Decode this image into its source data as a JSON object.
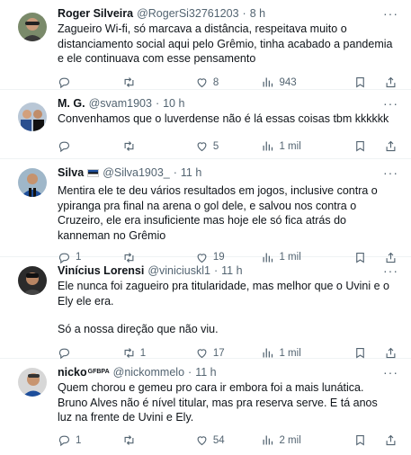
{
  "tweets": [
    {
      "name": "Roger Silveira",
      "handle": "@RogerSi32761203",
      "time": "8 h",
      "text": [
        "Zagueiro Wi-fi, só marcava a distância, respeitava muito o distanciamento social aqui pelo Grêmio, tinha acabado a pandemia e ele continuava com esse pensamento"
      ],
      "replies": "",
      "reposts": "",
      "likes": "8",
      "views": "943"
    },
    {
      "name": "M. G.",
      "handle": "@svam1903",
      "time": "10 h",
      "text": [
        "Convenhamos que o luverdense não é lá essas coisas tbm kkkkkk"
      ],
      "replies": "",
      "reposts": "",
      "likes": "5",
      "views": "1 mil"
    },
    {
      "name": "Silva",
      "handle": "@Silva1903_",
      "time": "11 h",
      "text": [
        "Mentira ele te deu vários resultados em jogos, inclusive contra o ypiranga pra final na arena o gol dele, e salvou nos contra o Cruzeiro, ele era insuficiente mas hoje ele só fica atrás do kanneman no Grêmio"
      ],
      "replies": "1",
      "reposts": "",
      "likes": "19",
      "views": "1 mil"
    },
    {
      "name": "Vinícius Lorensi",
      "handle": "@viniciuskl1",
      "time": "11 h",
      "text": [
        "Ele nunca foi zagueiro pra titularidade, mas melhor que o Uvini e o Ely ele era.",
        "Só a nossa direção que não viu."
      ],
      "replies": "",
      "reposts": "1",
      "likes": "17",
      "views": "1 mil"
    },
    {
      "name": "nicko",
      "name_sup": "GFBPA",
      "handle": "@nickommelo",
      "time": "11 h",
      "text": [
        "Quem chorou e gemeu pro cara ir embora foi a mais lunática. Bruno Alves não é nível titular, mas pra reserva serve. E tá anos luz na frente de Uvini e Ely."
      ],
      "replies": "1",
      "reposts": "",
      "likes": "54",
      "views": "2 mil"
    }
  ],
  "colors": {
    "text": "#0f1419",
    "muted": "#536471",
    "divider": "#eff3f4"
  },
  "icons": [
    "reply-icon",
    "repost-icon",
    "like-icon",
    "views-icon",
    "bookmark-icon",
    "share-icon",
    "more-icon"
  ]
}
